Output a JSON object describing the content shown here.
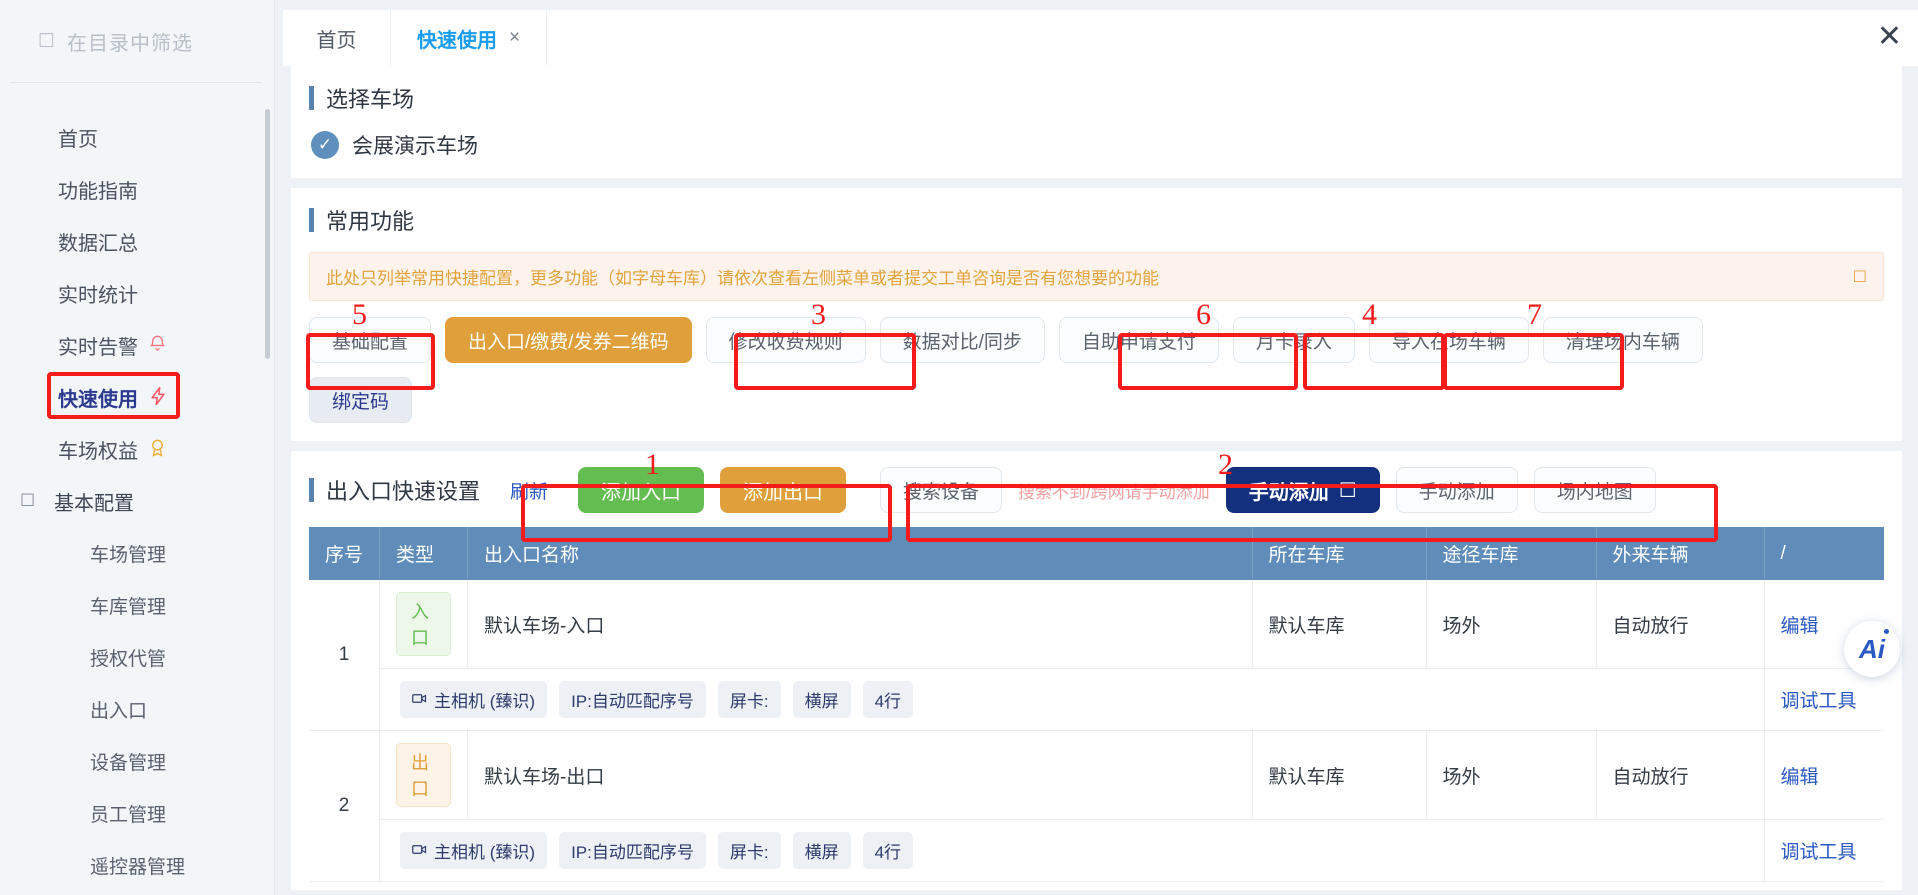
{
  "sidebar": {
    "filter": {
      "placeholder": "在目录中筛选",
      "icon": "search-icon"
    },
    "items": [
      {
        "label": "首页",
        "icon": "",
        "type": "item"
      },
      {
        "label": "功能指南",
        "icon": "",
        "type": "item"
      },
      {
        "label": "数据汇总",
        "icon": "",
        "type": "item"
      },
      {
        "label": "实时统计",
        "icon": "",
        "type": "item"
      },
      {
        "label": "实时告警",
        "icon": "bell-icon",
        "type": "item"
      },
      {
        "label": "快速使用",
        "icon": "bolt-icon",
        "type": "item",
        "active": true
      },
      {
        "label": "车场权益",
        "icon": "medal-icon",
        "type": "item"
      },
      {
        "label": "基本配置",
        "icon": "settings-icon",
        "type": "group"
      },
      {
        "label": "车场管理",
        "icon": "",
        "type": "sub"
      },
      {
        "label": "车库管理",
        "icon": "",
        "type": "sub"
      },
      {
        "label": "授权代管",
        "icon": "",
        "type": "sub"
      },
      {
        "label": "出入口",
        "icon": "",
        "type": "sub"
      },
      {
        "label": "设备管理",
        "icon": "",
        "type": "sub"
      },
      {
        "label": "员工管理",
        "icon": "",
        "type": "sub"
      },
      {
        "label": "遥控器管理",
        "icon": "",
        "type": "sub"
      }
    ]
  },
  "tabs": [
    {
      "label": "首页",
      "active": false,
      "closable": false
    },
    {
      "label": "快速使用",
      "active": true,
      "closable": true,
      "close": "×"
    }
  ],
  "window": {
    "close": "✕"
  },
  "select_lot": {
    "title": "选择车场",
    "checked_icon": "check-icon",
    "name": "会展演示车场"
  },
  "common_functions": {
    "title": "常用功能",
    "alert_text": "此处只列举常用快捷配置，更多功能（如字母车库）请依次查看左侧菜单或者提交工单咨询是否有您想要的功能",
    "alert_close": "✕",
    "buttons": [
      {
        "label": "基础配置",
        "style": "default"
      },
      {
        "label": "出入口/缴费/发券二维码",
        "style": "warn"
      },
      {
        "label": "修改收费规则",
        "style": "default"
      },
      {
        "label": "数据对比/同步",
        "style": "default"
      },
      {
        "label": "自助申请支付",
        "style": "default"
      },
      {
        "label": "月卡录入",
        "style": "default"
      },
      {
        "label": "导入在场车辆",
        "style": "default"
      },
      {
        "label": "清理场内车辆",
        "style": "default"
      }
    ],
    "buttons_row2": [
      {
        "label": "绑定码",
        "style": "plain"
      }
    ]
  },
  "gate_setup": {
    "title": "出入口快速设置",
    "refresh_label": "刷新",
    "add_entry_label": "添加入口",
    "add_exit_label": "添加出口",
    "search_device_label": "搜索设备",
    "search_hint": "搜索不到/跨网请手动添加",
    "manual_add_primary": "手动添加",
    "manual_add_primary_icon": "caret-down-icon",
    "manual_add_label": "手动添加",
    "map_label": "场内地图"
  },
  "table": {
    "headers": [
      "序号",
      "类型",
      "出入口名称",
      "所在车库",
      "途径车库",
      "外来车辆",
      "/"
    ],
    "rows": [
      {
        "seq": "1",
        "type": "入口",
        "type_style": "in",
        "name": "默认车场-入口",
        "garage": "默认车库",
        "via": "场外",
        "outside": "自动放行",
        "action": "编辑",
        "detail_chips": [
          "主相机 (臻识)",
          "IP:自动匹配序号",
          "屏卡:",
          "横屏",
          "4行"
        ],
        "detail_action": "调试工具"
      },
      {
        "seq": "2",
        "type": "出口",
        "type_style": "out",
        "name": "默认车场-出口",
        "garage": "默认车库",
        "via": "场外",
        "outside": "自动放行",
        "action": "编辑",
        "detail_chips": [
          "主相机 (臻识)",
          "IP:自动匹配序号",
          "屏卡:",
          "横屏",
          "4行"
        ],
        "detail_action": "调试工具"
      }
    ]
  },
  "annotations": [
    {
      "num": "1"
    },
    {
      "num": "2"
    },
    {
      "num": "3"
    },
    {
      "num": "4"
    },
    {
      "num": "5"
    },
    {
      "num": "6"
    },
    {
      "num": "7"
    }
  ],
  "ai_badge": {
    "label": "Ai"
  },
  "colors": {
    "accent_blue": "#1a9cf0",
    "primary_dark": "#12307e",
    "warn_orange": "#dfa03b",
    "green": "#64bd51",
    "header_blue": "#5f8cb8",
    "annotation_red": "#f51b1b"
  }
}
